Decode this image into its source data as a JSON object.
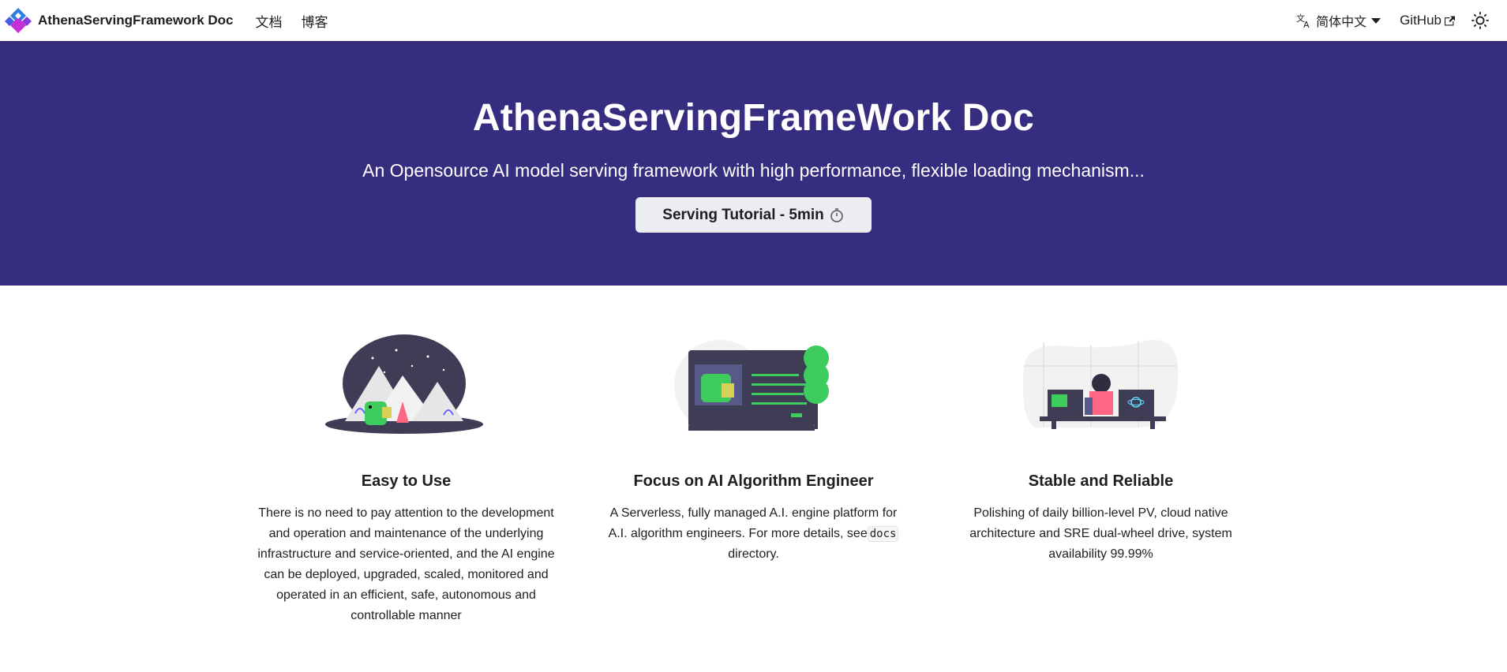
{
  "navbar": {
    "brand": "AthenaServingFramework Doc",
    "links": [
      "文档",
      "博客"
    ],
    "language": "简体中文",
    "github": "GitHub"
  },
  "hero": {
    "title": "AthenaServingFrameWork Doc",
    "subtitle": "An Opensource AI model serving framework with high performance, flexible loading mechanism...",
    "button": "Serving Tutorial - 5min"
  },
  "features": [
    {
      "title": "Easy to Use",
      "description": "There is no need to pay attention to the development and operation and maintenance of the underlying infrastructure and service-oriented, and the AI engine can be deployed, upgraded, scaled, monitored and operated in an efficient, safe, autonomous and controllable manner",
      "icon": "mountain-dinosaur-illustration"
    },
    {
      "title": "Focus on AI Algorithm Engineer",
      "description_before": "A Serverless, fully managed A.I. engine platform for A.I. algorithm engineers. For more details, see",
      "description_code": "docs",
      "description_after": " directory.",
      "icon": "monitor-dinosaur-illustration"
    },
    {
      "title": "Stable and Reliable",
      "description": "Polishing of daily billion-level PV, cloud native architecture and SRE dual-wheel drive, system availability 99.99%",
      "icon": "developer-desk-illustration"
    }
  ],
  "colors": {
    "hero_bg": "#372d80",
    "accent_green": "#3ecc5f"
  }
}
